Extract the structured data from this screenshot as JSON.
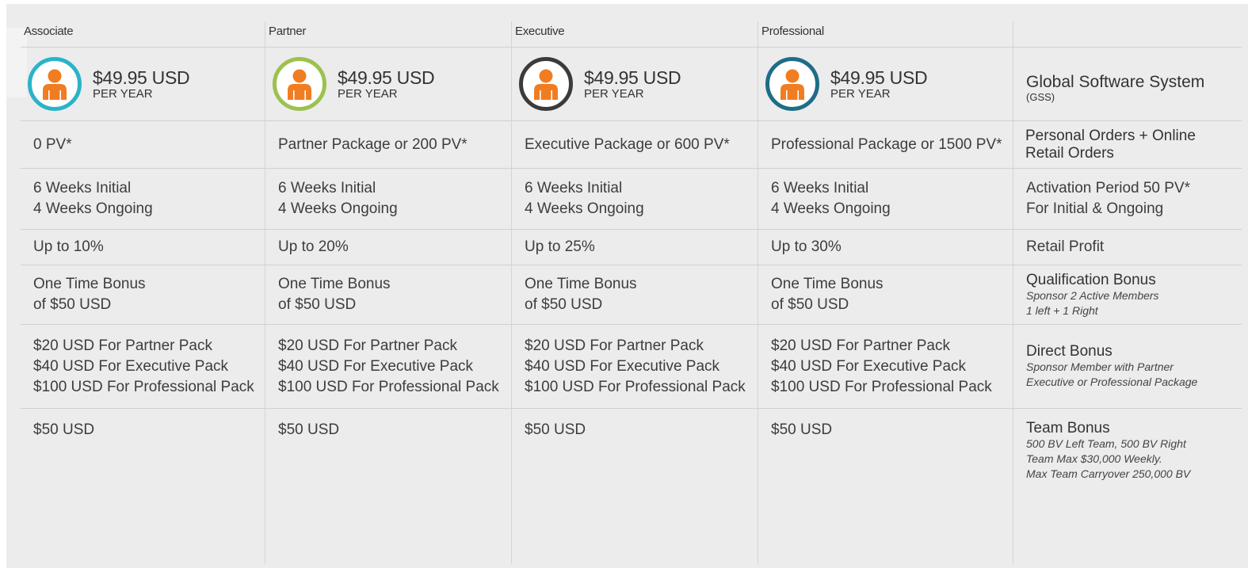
{
  "tiers": [
    {
      "name": "Associate",
      "price": "$49.95 USD",
      "period": "PER YEAR",
      "ring": "#2bb3c8",
      "qualification": "0 PV*",
      "weeks_initial": "6 Weeks Initial",
      "weeks_ongoing": "4 Weeks Ongoing",
      "retail": "Up to 10%",
      "bonus_line1": "One Time Bonus",
      "bonus_line2": "of $50 USD",
      "direct_1": "$20 USD For Partner Pack",
      "direct_2": "$40 USD For Executive Pack",
      "direct_3": "$100 USD For Professional Pack",
      "team": "$50 USD"
    },
    {
      "name": "Partner",
      "price": "$49.95 USD",
      "period": "PER YEAR",
      "ring": "#9cc14f",
      "qualification": "Partner Package or 200 PV*",
      "weeks_initial": "6 Weeks Initial",
      "weeks_ongoing": "4 Weeks Ongoing",
      "retail": "Up to 20%",
      "bonus_line1": "One Time Bonus",
      "bonus_line2": "of $50 USD",
      "direct_1": "$20 USD For Partner Pack",
      "direct_2": "$40 USD For Executive Pack",
      "direct_3": "$100 USD For Professional Pack",
      "team": "$50 USD"
    },
    {
      "name": "Executive",
      "price": "$49.95 USD",
      "period": "PER YEAR",
      "ring": "#3b3b3b",
      "qualification": "Executive Package or 600 PV*",
      "weeks_initial": "6 Weeks Initial",
      "weeks_ongoing": "4 Weeks Ongoing",
      "retail": "Up to 25%",
      "bonus_line1": "One Time Bonus",
      "bonus_line2": "of $50 USD",
      "direct_1": "$20 USD For Partner Pack",
      "direct_2": "$40 USD For Executive Pack",
      "direct_3": "$100 USD For Professional Pack",
      "team": "$50 USD"
    },
    {
      "name": "Professional",
      "price": "$49.95 USD",
      "period": "PER YEAR",
      "ring": "#1e6d86",
      "qualification": "Professional Package or 1500 PV*",
      "weeks_initial": "6 Weeks Initial",
      "weeks_ongoing": "4 Weeks Ongoing",
      "retail": "Up to 30%",
      "bonus_line1": "One Time Bonus",
      "bonus_line2": "of $50 USD",
      "direct_1": "$20 USD For Partner Pack",
      "direct_2": "$40 USD For Executive Pack",
      "direct_3": "$100 USD For Professional Pack",
      "team": "$50 USD"
    }
  ],
  "labels": {
    "gss_title": "Global Software System",
    "gss_sub": "(GSS)",
    "orders_line1": "Personal Orders + Online",
    "orders_line2": "Retail Orders",
    "activation_line1": "Activation Period 50 PV*",
    "activation_line2": "For Initial & Ongoing",
    "retail_profit": "Retail Profit",
    "qualification_bonus": "Qualification Bonus",
    "qualification_note1": "Sponsor 2 Active Members",
    "qualification_note2": "1 left + 1 Right",
    "direct_bonus": "Direct Bonus",
    "direct_note1": "Sponsor Member with Partner",
    "direct_note2": "Executive or Professional Package",
    "team_bonus": "Team Bonus",
    "team_note1": "500 BV Left Team, 500 BV Right",
    "team_note2": "Team Max $30,000 Weekly.",
    "team_note3": "Max Team Carryover 250,000 BV"
  },
  "icons": {
    "avatar": "person-icon",
    "avatar_color": "#f07d22"
  }
}
